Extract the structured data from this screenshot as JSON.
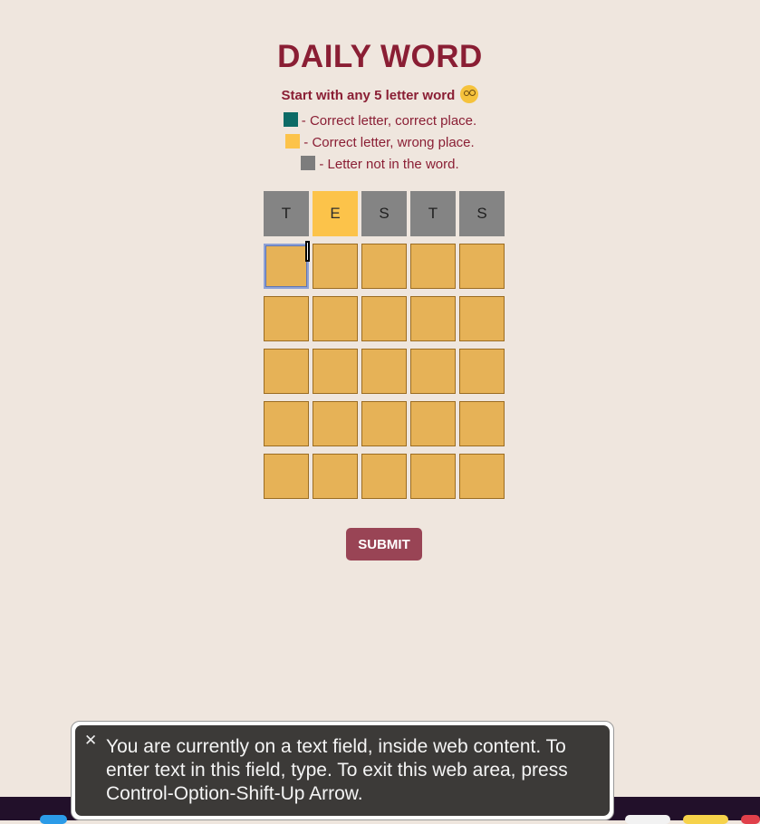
{
  "header": {
    "title": "DAILY WORD",
    "subtitle": "Start with any 5 letter word"
  },
  "legend": [
    {
      "color": "#0d6b66",
      "text": "- Correct letter, correct place."
    },
    {
      "color": "#fcc34a",
      "text": "- Correct letter, wrong place."
    },
    {
      "color": "#7d7d7d",
      "text": "- Letter not in the word."
    }
  ],
  "board": {
    "guess": [
      {
        "letter": "T",
        "state": "absent"
      },
      {
        "letter": "E",
        "state": "present"
      },
      {
        "letter": "S",
        "state": "absent"
      },
      {
        "letter": "T",
        "state": "absent"
      },
      {
        "letter": "S",
        "state": "absent"
      }
    ]
  },
  "submit": {
    "label": "SUBMIT"
  },
  "voiceover": {
    "message": "You are currently on a text field, inside web content. To enter text in this field, type. To exit this web area, press Control-Option-Shift-Up Arrow."
  },
  "colors": {
    "title": "#8a1e34",
    "background": "#efe6de",
    "absent": "#848484",
    "present": "#fcc34a",
    "input": "#e6b257",
    "submit": "#994455"
  }
}
